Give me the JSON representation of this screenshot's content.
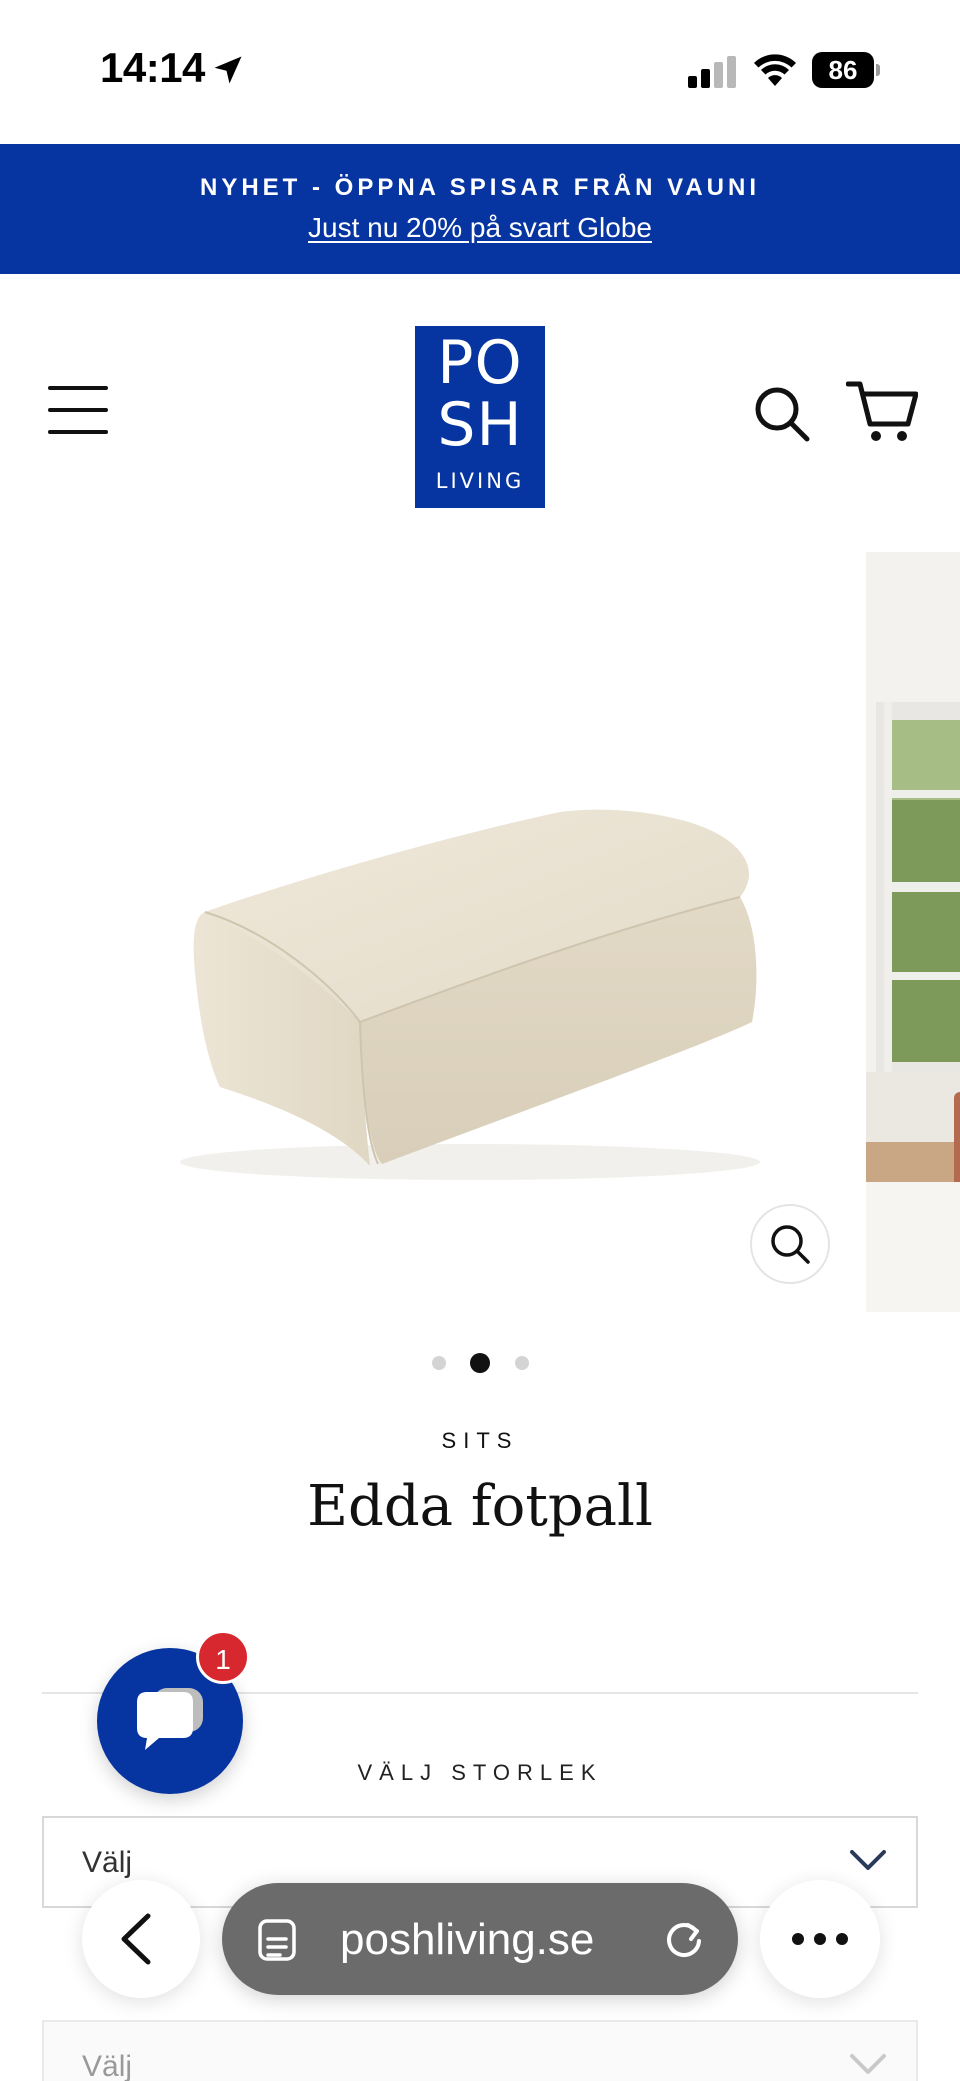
{
  "status_bar": {
    "time": "14:14",
    "battery": "86"
  },
  "announcement": {
    "headline": "NYHET - ÖPPNA SPISAR FRÅN VAUNI",
    "link": "Just nu 20% på svart Globe"
  },
  "header": {
    "logo_line1": "PO",
    "logo_line2": "SH",
    "logo_line3": "LIVING"
  },
  "product": {
    "category": "SITS",
    "title": "Edda fotpall",
    "gallery_slides": 3,
    "active_slide": 2
  },
  "options": {
    "size_label": "VÄLJ STORLEK",
    "size_value": "Välj",
    "second_value": "Välj"
  },
  "chat": {
    "badge_count": "1"
  },
  "browser": {
    "url": "poshliving.se"
  },
  "colors": {
    "brand_blue": "#0634a0",
    "badge_red": "#d7282f",
    "url_bar": "#6b6b6b"
  },
  "icons": [
    "location-arrow-icon",
    "signal-icon",
    "wifi-icon",
    "battery-icon",
    "hamburger-menu-icon",
    "search-icon",
    "cart-icon",
    "zoom-icon",
    "chevron-down-icon",
    "chat-bubble-icon",
    "back-chevron-icon",
    "tabs-icon",
    "reload-icon",
    "more-icon"
  ]
}
